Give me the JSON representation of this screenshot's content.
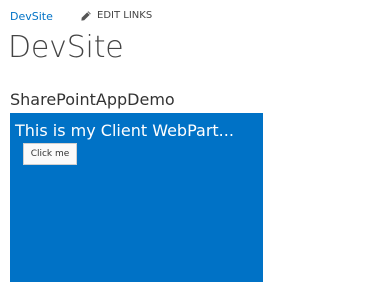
{
  "top_nav": {
    "site_link_label": "DevSite",
    "edit_links_label": "EDIT LINKS",
    "edit_links_icon": "pencil-icon"
  },
  "page": {
    "title": "DevSite"
  },
  "webpart": {
    "title": "SharePointAppDemo",
    "content": {
      "heading": "This is my Client WebPart...",
      "button_label": "Click me"
    }
  },
  "colors": {
    "accent": "#0072c6",
    "text_dark": "#444444",
    "background": "#ffffff"
  }
}
